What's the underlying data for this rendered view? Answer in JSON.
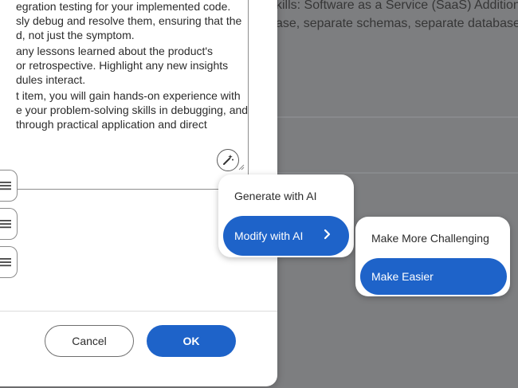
{
  "background": {
    "line1": "kills: Software as a Service (SaaS) Addition",
    "line2": "ase, separate schemas, separate database"
  },
  "dialog": {
    "description_lines": [
      "egration testing for your implemented code.",
      "sly debug and resolve them, ensuring that the",
      "d, not just the symptom.",
      "any lessons learned about the product's",
      "or retrospective. Highlight any new insights",
      "dules interact.",
      "t item, you will gain hands-on experience with",
      "e your problem-solving skills in debugging, and",
      " through practical application and direct"
    ],
    "ai_button_icon": "magic-wand-icon",
    "cancel_label": "Cancel",
    "ok_label": "OK"
  },
  "ai_menu": {
    "items": [
      {
        "label": "Generate with AI"
      },
      {
        "label": "Modify with AI"
      }
    ]
  },
  "modify_submenu": {
    "items": [
      {
        "label": "Make More Challenging"
      },
      {
        "label": "Make Easier"
      }
    ]
  },
  "colors": {
    "accent": "#1e63c9",
    "overlay": "#7d7e80"
  }
}
